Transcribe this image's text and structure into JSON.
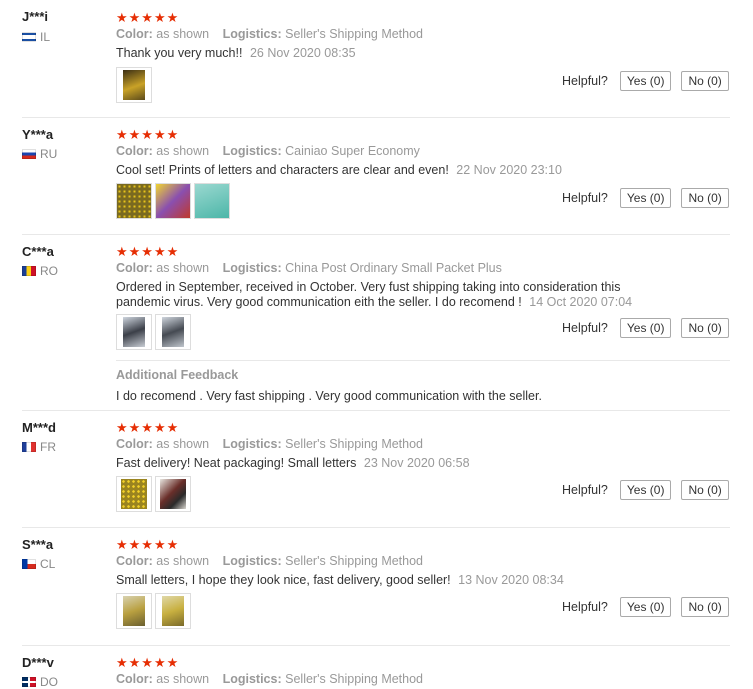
{
  "labels": {
    "color": "Color:",
    "logistics": "Logistics:",
    "helpful": "Helpful?",
    "additional_feedback": "Additional Feedback"
  },
  "stars": "★★★★★",
  "reviews": [
    {
      "name": "J***i",
      "country": "IL",
      "color_value": "as shown",
      "logistics_value": "Seller's Shipping Method",
      "text": "Thank you very much!!",
      "date": "26 Nov 2020 08:35",
      "yes": "Yes (0)",
      "no": "No (0)"
    },
    {
      "name": "Y***a",
      "country": "RU",
      "color_value": "as shown",
      "logistics_value": "Cainiao Super Economy",
      "text": "Cool set! Prints of letters and characters are clear and even!",
      "date": "22 Nov 2020 23:10",
      "yes": "Yes (0)",
      "no": "No (0)"
    },
    {
      "name": "C***a",
      "country": "RO",
      "color_value": "as shown",
      "logistics_value": "China Post Ordinary Small Packet Plus",
      "text": "Ordered in September, received in October. Very fust shipping taking into consideration this pandemic virus. Very good communication eith the seller. I do recomend !",
      "date": "14 Oct 2020 07:04",
      "yes": "Yes (0)",
      "no": "No (0)",
      "additional": "I do recomend . Very fast shipping . Very good communication with the seller."
    },
    {
      "name": "M***d",
      "country": "FR",
      "color_value": "as shown",
      "logistics_value": "Seller's Shipping Method",
      "text": "Fast delivery! Neat packaging! Small letters",
      "date": "23 Nov 2020 06:58",
      "yes": "Yes (0)",
      "no": "No (0)"
    },
    {
      "name": "S***a",
      "country": "CL",
      "color_value": "as shown",
      "logistics_value": "Seller's Shipping Method",
      "text": "Small letters, I hope they look nice, fast delivery, good seller!",
      "date": "13 Nov 2020 08:34",
      "yes": "Yes (0)",
      "no": "No (0)"
    },
    {
      "name": "D***v",
      "country": "DO",
      "color_value": "as shown",
      "logistics_value": "Seller's Shipping Method"
    }
  ]
}
